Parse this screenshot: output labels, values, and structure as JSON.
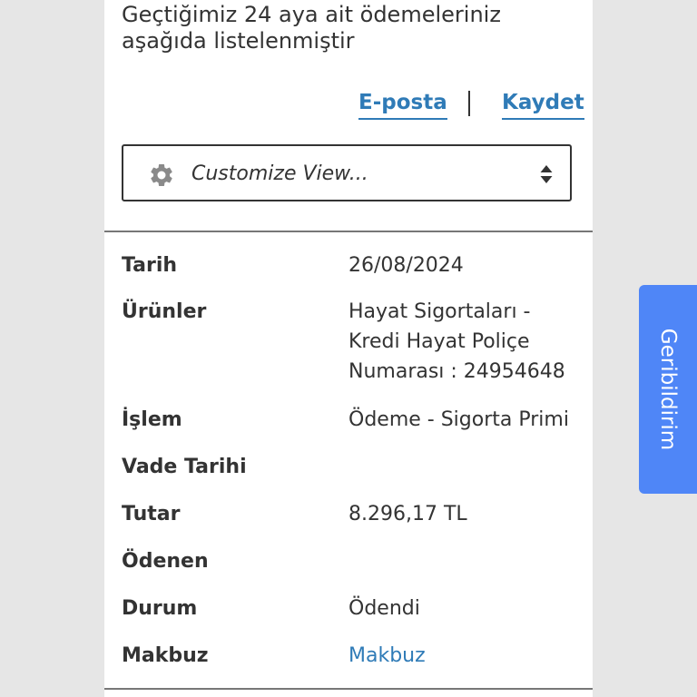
{
  "intro": {
    "line1": "Geçtiğimiz 24 aya ait ödemeleriniz",
    "line2": "aşağıda listelenmiştir"
  },
  "actions": {
    "email_label": "E-posta",
    "save_label": "Kaydet"
  },
  "customize": {
    "label": "Customize View...",
    "icon_left": "gear-icon",
    "icon_right": "sort-updown-icon"
  },
  "record": {
    "date_label": "Tarih",
    "date_value": "26/08/2024",
    "products_label": "Ürünler",
    "products_value_lines": [
      "Hayat Sigortaları -",
      "Kredi Hayat Poliçe",
      "Numarası : 24954648"
    ],
    "transaction_label": "İşlem",
    "transaction_value": "Ödeme - Sigorta Primi",
    "due_date_label": "Vade Tarihi",
    "amount_label": "Tutar",
    "amount_value": "8.296,17 TL",
    "paid_label": "Ödenen",
    "status_label": "Durum",
    "status_value": "Ödendi",
    "receipt_label": "Makbuz",
    "receipt_link": "Makbuz"
  },
  "feedback": {
    "label": "Geribildirim"
  },
  "colors": {
    "link": "#2f7bb7",
    "feedback_bg": "#4f86f7",
    "text": "#333333",
    "page_bg": "#e6e6e6"
  }
}
